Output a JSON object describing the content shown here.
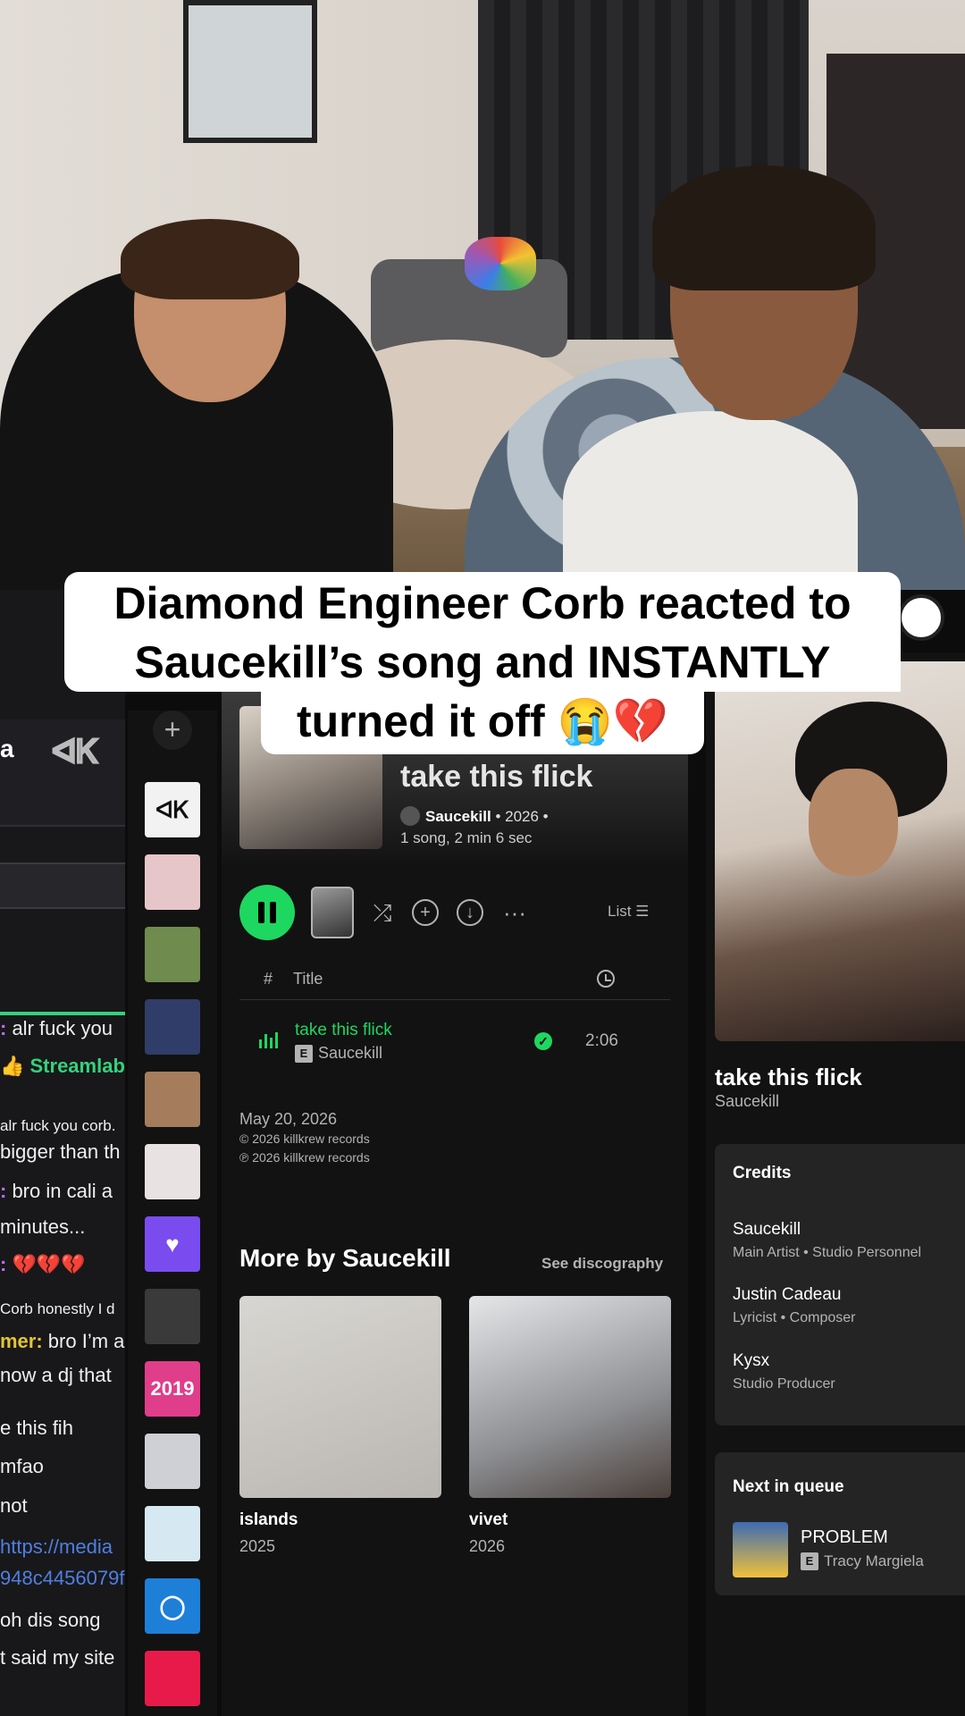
{
  "caption": {
    "line1": "Diamond Engineer Corb reacted to",
    "line2": "Saucekill’s song and INSTANTLY",
    "line3": "turned it off 😭💔"
  },
  "chat": {
    "logo": "a",
    "logo2": "ᐊᏦ",
    "lines": [
      {
        "user": ":",
        "text": " alr fuck you"
      },
      {
        "user": "👍 Streamlabs:",
        "text": ""
      },
      {
        "user": "",
        "text": "alr fuck you corb."
      },
      {
        "user": "",
        "text": "bigger than th"
      },
      {
        "user": ":",
        "text": " bro in cali a"
      },
      {
        "user": "",
        "text": "minutes..."
      },
      {
        "user": ":",
        "text": " 💔💔💔"
      },
      {
        "user": "",
        "text": "Corb honestly I d"
      },
      {
        "user": "mer:",
        "text": " bro I’m a"
      },
      {
        "user": "",
        "text": "now a dj that"
      },
      {
        "user": "",
        "text": "e this fih"
      },
      {
        "user": "",
        "text": "mfao"
      },
      {
        "user": "",
        "text": " not"
      },
      {
        "user": "",
        "text": "https://media"
      },
      {
        "user": "",
        "text": "948c4456079f"
      },
      {
        "user": "",
        "text": " oh dis song"
      },
      {
        "user": "",
        "text": "t said my site"
      }
    ]
  },
  "rail": {
    "add_label": "+",
    "thumbs": [
      {
        "label": "ᐊᏦ",
        "bg": "#f2f2f2"
      },
      {
        "label": "",
        "bg": "#e7c6c9"
      },
      {
        "label": "",
        "bg": "#6f8b4e"
      },
      {
        "label": "",
        "bg": "#2f3d68"
      },
      {
        "label": "",
        "bg": "#a57d5c"
      },
      {
        "label": "",
        "bg": "#e8e3e2"
      },
      {
        "label": "♥",
        "bg": "#7a4cf0"
      },
      {
        "label": "",
        "bg": "#3a3a3a"
      },
      {
        "label": "2019",
        "bg": "#e03d8a"
      },
      {
        "label": "",
        "bg": "#cfcfd6"
      },
      {
        "label": "",
        "bg": "#d6e9f2"
      },
      {
        "label": "◯",
        "bg": "#1e7fd8"
      },
      {
        "label": "",
        "bg": "#e81a4a"
      }
    ]
  },
  "album": {
    "title": "take this flick",
    "artist": "Saucekill",
    "year_meta": " • 2026 •",
    "summary": "1 song, 2 min 6 sec",
    "list_label": "List ☰",
    "col_hash": "#",
    "col_title": "Title",
    "track": {
      "title": "take this flick",
      "explicit": "E",
      "artist": "Saucekill",
      "duration": "2:06"
    },
    "release_date": "May 20, 2026",
    "copyright_c": "© 2026 killkrew records",
    "copyright_p": "℗ 2026 killkrew records",
    "more_title": "More by Saucekill",
    "see_discography": "See discography",
    "discography": [
      {
        "title": "islands",
        "year": "2025"
      },
      {
        "title": "vivet",
        "year": "2026"
      }
    ]
  },
  "now_playing": {
    "title": "take this flick",
    "artist": "Saucekill",
    "credits_heading": "Credits",
    "credits": [
      {
        "name": "Saucekill",
        "role": "Main Artist • Studio Personnel"
      },
      {
        "name": "Justin Cadeau",
        "role": "Lyricist • Composer"
      },
      {
        "name": "Kysx",
        "role": "Studio Producer"
      }
    ],
    "queue_heading": "Next in queue",
    "queue": {
      "title": "PROBLEM",
      "explicit": "E",
      "artist": "Tracy Margiela"
    }
  },
  "colors": {
    "spotify_green": "#1ed760",
    "panel_bg": "#121212"
  }
}
